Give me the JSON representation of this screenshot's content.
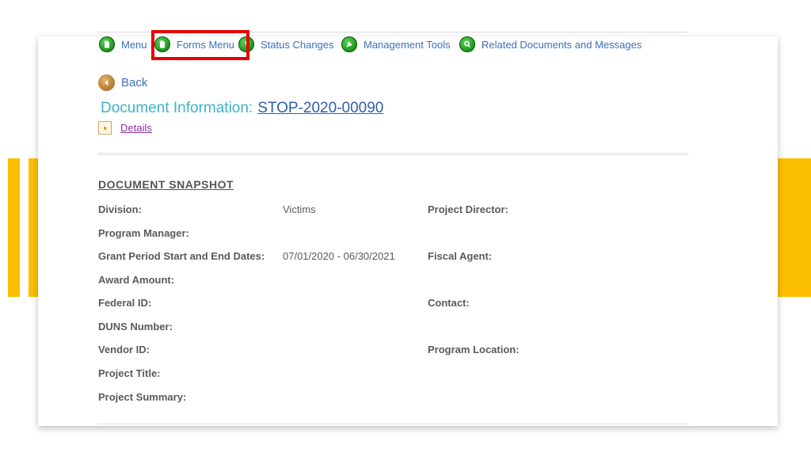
{
  "nav": {
    "menu": "Menu",
    "forms_menu": "Forms Menu",
    "status_changes": "Status Changes",
    "management_tools": "Management Tools",
    "related_documents": "Related Documents and Messages"
  },
  "back_label": "Back",
  "document": {
    "title_prefix": "Document Information:",
    "id": "STOP-2020-00090",
    "details_label": "Details"
  },
  "snapshot": {
    "title": "DOCUMENT SNAPSHOT",
    "division_label": "Division:",
    "division_value": "Victims",
    "project_director_label": "Project Director:",
    "program_manager_label": "Program Manager:",
    "grant_period_label": "Grant Period Start and End Dates:",
    "grant_period_value": "07/01/2020 - 06/30/2021",
    "fiscal_agent_label": "Fiscal Agent:",
    "award_amount_label": "Award Amount:",
    "federal_id_label": "Federal ID:",
    "contact_label": "Contact:",
    "duns_label": "DUNS Number:",
    "vendor_id_label": "Vendor ID:",
    "program_location_label": "Program Location:",
    "project_title_label": "Project Title:",
    "project_summary_label": "Project Summary:"
  },
  "colors": {
    "accent_yellow": "#fbbf00",
    "highlight_red": "#e60000",
    "link_blue": "#3a6fbd",
    "title_teal": "#3bb4c9"
  }
}
